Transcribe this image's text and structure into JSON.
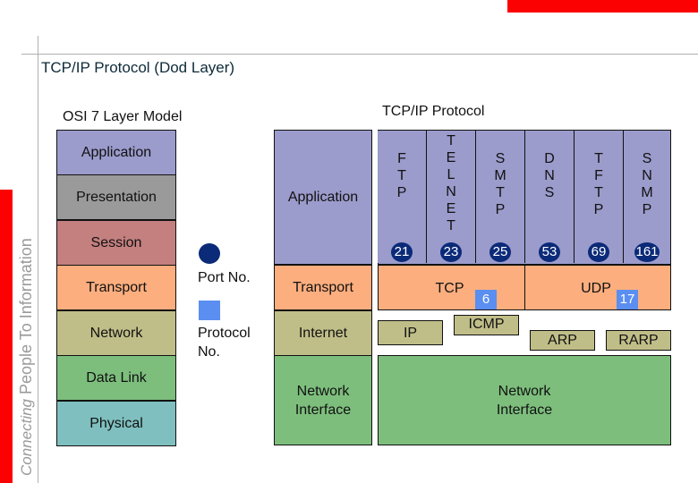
{
  "header": {
    "title": "TCP/IP Protocol (Dod Layer)",
    "tagline_italic": "Connecting",
    "tagline_rest": " People To Information"
  },
  "osi": {
    "title": "OSI 7 Layer Model",
    "layers": [
      {
        "label": "Application",
        "color": "#9b9bcc"
      },
      {
        "label": "Presentation",
        "color": "#9a9a9a"
      },
      {
        "label": "Session",
        "color": "#c47f7f"
      },
      {
        "label": "Transport",
        "color": "#fcae7e"
      },
      {
        "label": "Network",
        "color": "#c0be88"
      },
      {
        "label": "Data Link",
        "color": "#7dbe7d"
      },
      {
        "label": "Physical",
        "color": "#7fbfbf"
      }
    ]
  },
  "legend": {
    "port_label": "Port No.",
    "protocol_label_line1": "Protocol",
    "protocol_label_line2": "No.",
    "port_color": "#0b2a78",
    "protocol_color": "#5a8ef0"
  },
  "tcpip": {
    "title": "TCP/IP Protocol",
    "layers": {
      "application": "Application",
      "transport": "Transport",
      "internet": "Internet",
      "network_interface_line1": "Network",
      "network_interface_line2": "Interface"
    },
    "app_protocols": [
      {
        "name": "FTP",
        "letters": [
          "F",
          "T",
          "P"
        ],
        "port": "21"
      },
      {
        "name": "TELNET",
        "letters": [
          "T",
          "E",
          "L",
          "N",
          "E",
          "T"
        ],
        "port": "23"
      },
      {
        "name": "SMTP",
        "letters": [
          "S",
          "M",
          "T",
          "P"
        ],
        "port": "25"
      },
      {
        "name": "DNS",
        "letters": [
          "D",
          "N",
          "S"
        ],
        "port": "53"
      },
      {
        "name": "TFTP",
        "letters": [
          "T",
          "F",
          "T",
          "P"
        ],
        "port": "69"
      },
      {
        "name": "SNMP",
        "letters": [
          "S",
          "N",
          "M",
          "P"
        ],
        "port": "161"
      }
    ],
    "transport_protocols": [
      {
        "name": "TCP",
        "protocol_no": "6"
      },
      {
        "name": "UDP",
        "protocol_no": "17"
      }
    ],
    "internet_protocols": [
      "IP",
      "ICMP",
      "ARP",
      "RARP"
    ],
    "network_interface_line1": "Network",
    "network_interface_line2": "Interface"
  },
  "accent_color": "#fb0102"
}
